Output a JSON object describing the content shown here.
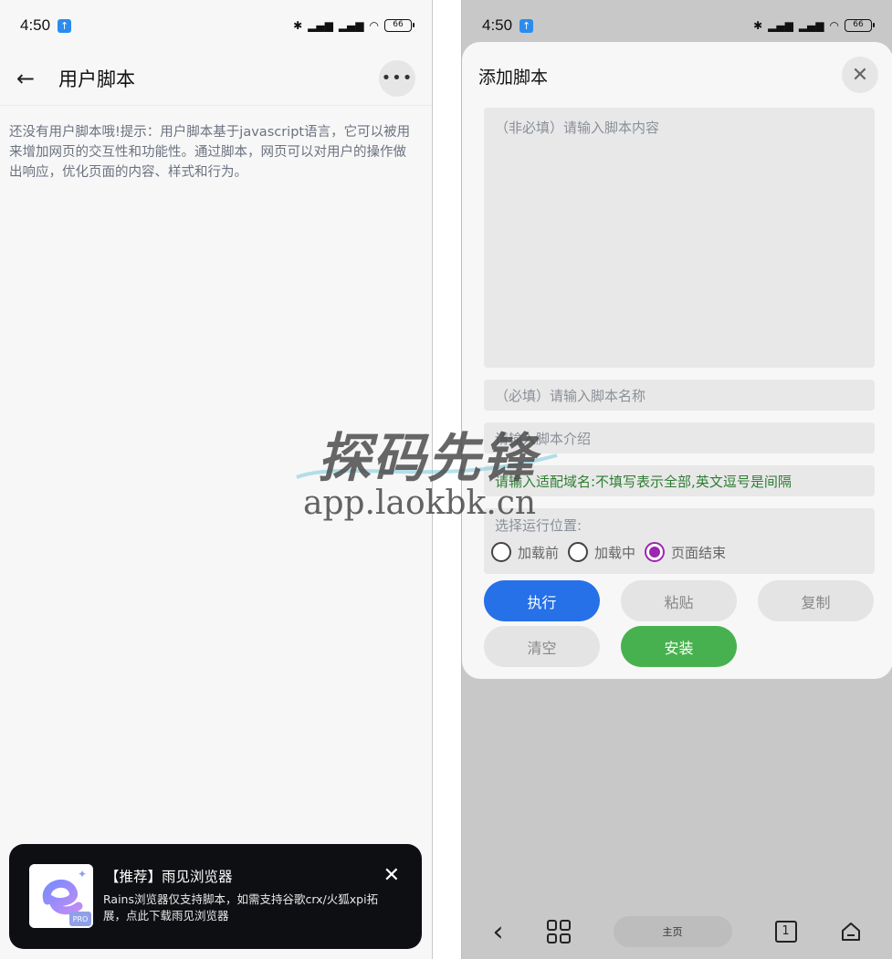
{
  "status_bar": {
    "time": "4:50",
    "battery": "66"
  },
  "left": {
    "title": "用户脚本",
    "tip": "还没有用户脚本哦!提示：用户脚本基于javascript语言，它可以被用来增加网页的交互性和功能性。通过脚本，网页可以对用户的操作做出响应，优化页面的内容、样式和行为。",
    "promo": {
      "title": "【推荐】雨见浏览器",
      "description": "Rains浏览器仅支持脚本，如需支持谷歌crx/火狐xpi拓展，点此下载雨见浏览器",
      "logo_badge": "PRO"
    }
  },
  "right": {
    "sheet_title": "添加脚本",
    "content_placeholder": "（非必填）请输入脚本内容",
    "name_placeholder": "（必填）请输入脚本名称",
    "desc_placeholder": "请输入脚本介绍",
    "domain_placeholder": "请输入适配域名:不填写表示全部,英文逗号是间隔",
    "run_label": "选择运行位置:",
    "run_options": [
      {
        "label": "加载前",
        "selected": false
      },
      {
        "label": "加载中",
        "selected": false
      },
      {
        "label": "页面结束",
        "selected": true
      }
    ],
    "buttons": {
      "execute": "执行",
      "paste": "粘贴",
      "copy": "复制",
      "clear": "清空",
      "install": "安装"
    },
    "nav": {
      "home": "主页",
      "tabs_count": "1"
    }
  },
  "watermark": {
    "title": "探码先锋",
    "url": "app.laokbk.cn"
  },
  "colors": {
    "primary_blue": "#2670e8",
    "install_green": "#48b14f",
    "radio_purple": "#9c27b0",
    "domain_green": "#2e7d32"
  }
}
